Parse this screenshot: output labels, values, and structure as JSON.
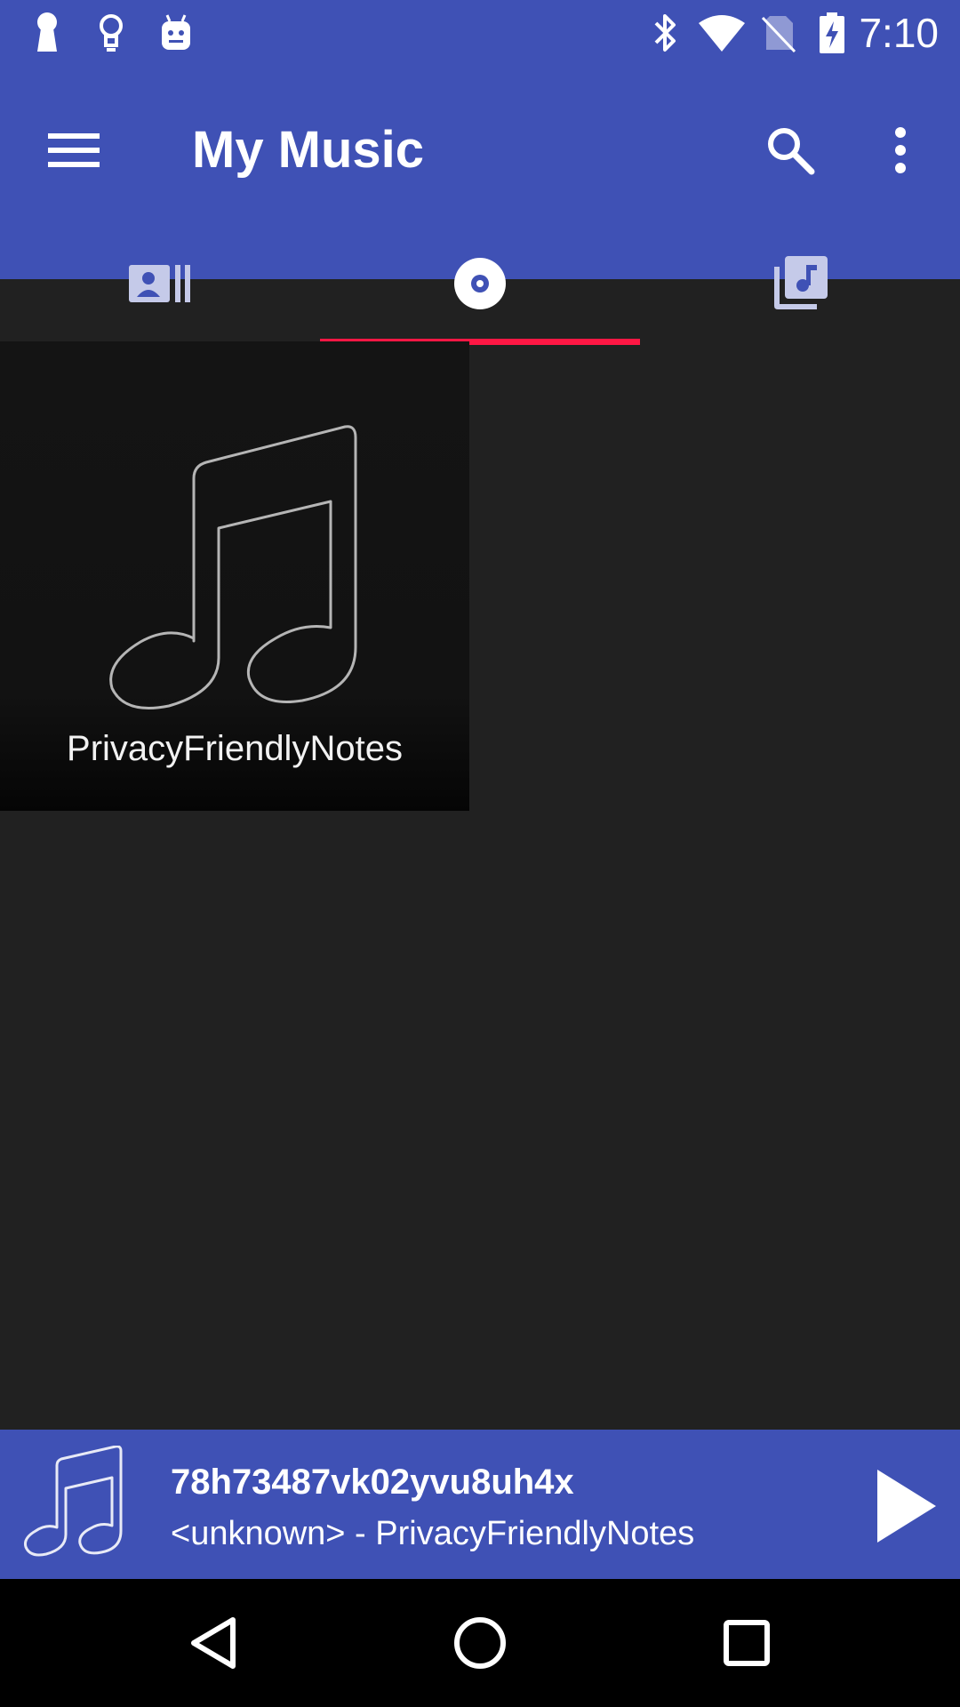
{
  "status_bar": {
    "time": "7:10",
    "left_icons": [
      "keyhole-icon",
      "lightbulb-icon",
      "android-icon"
    ],
    "right_icons": [
      "bluetooth-icon",
      "wifi-icon",
      "no-sim-icon",
      "battery-charging-icon"
    ]
  },
  "app_bar": {
    "title": "My Music",
    "menu_icon": "hamburger-menu-icon",
    "search_icon": "search-icon",
    "more_icon": "more-vert-icon",
    "background": "#3f51b5"
  },
  "tabs": [
    {
      "icon": "artists-icon",
      "active": false
    },
    {
      "icon": "album-disc-icon",
      "active": true
    },
    {
      "icon": "playlist-music-icon",
      "active": false
    }
  ],
  "tab_indicator_color": "#ff1744",
  "albums": [
    {
      "title": "PrivacyFriendlyNotes",
      "art_icon": "music-note-icon"
    }
  ],
  "now_playing": {
    "title": "78h73487vk02yvu8uh4x",
    "subtitle": "<unknown> - PrivacyFriendlyNotes",
    "art_icon": "music-note-icon",
    "play_icon": "play-icon"
  },
  "nav_bar": {
    "back_icon": "back-triangle-icon",
    "home_icon": "home-circle-icon",
    "recents_icon": "recents-square-icon"
  }
}
